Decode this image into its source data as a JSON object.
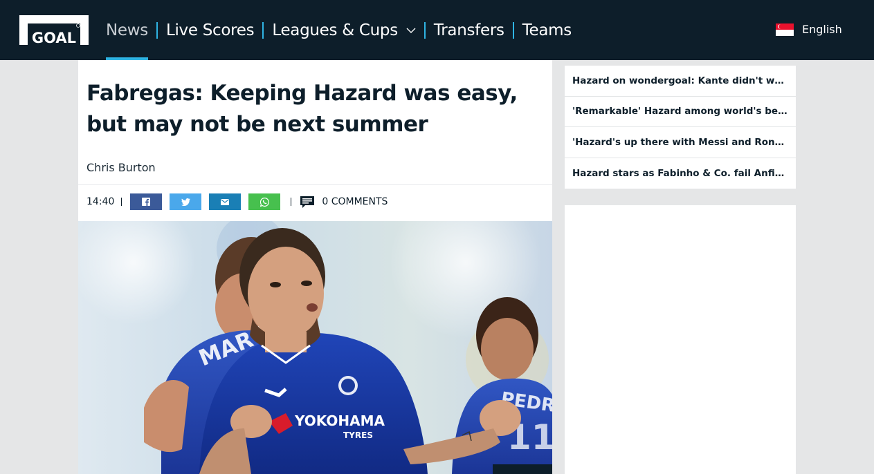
{
  "header": {
    "logo_text": "GOAL",
    "nav": [
      {
        "label": "News",
        "active": true
      },
      {
        "label": "Live Scores",
        "active": false
      },
      {
        "label": "Leagues & Cups",
        "active": false,
        "dropdown": true
      },
      {
        "label": "Transfers",
        "active": false
      },
      {
        "label": "Teams",
        "active": false
      }
    ],
    "language": "English",
    "language_flag_icon": "singapore-flag-icon"
  },
  "article": {
    "headline": "Fabregas: Keeping Hazard was easy, but may not be next summer",
    "author": "Chris Burton",
    "time": "14:40",
    "share_buttons": [
      {
        "name": "facebook",
        "icon": "facebook-icon",
        "color": "#3b5a99"
      },
      {
        "name": "twitter",
        "icon": "twitter-icon",
        "color": "#4aa8eb"
      },
      {
        "name": "email",
        "icon": "email-icon",
        "color": "#1a7fb5"
      },
      {
        "name": "whatsapp",
        "icon": "whatsapp-icon",
        "color": "#47c04e"
      }
    ],
    "comments_label": "0 COMMENTS"
  },
  "sidebar": {
    "related": [
      "Hazard on wondergoal: Kante didn't want to t...",
      "'Remarkable' Hazard among world's best - Zola",
      "'Hazard's up there with Messi and Ronaldo'",
      "Hazard stars as Fabinho & Co. fail Anfield audi..."
    ]
  },
  "colors": {
    "header_bg": "#0d1e2a",
    "accent": "#2fb4e3",
    "page_bg": "#e5e6e7"
  }
}
